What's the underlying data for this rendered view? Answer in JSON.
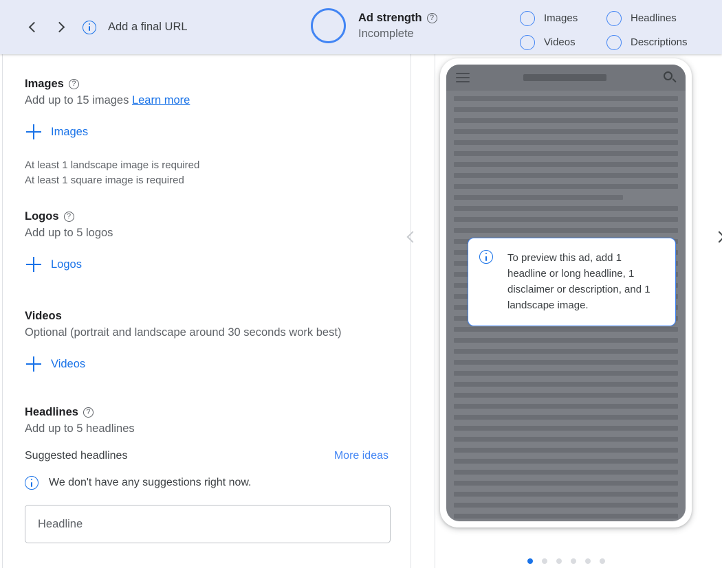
{
  "header": {
    "back_label": "Back",
    "forward_label": "Forward",
    "final_url_info_icon": "info-icon",
    "final_url_text": "Add a final URL",
    "ad_strength": {
      "label": "Ad strength",
      "help_icon": "help-icon",
      "status": "Incomplete",
      "progress": 0
    },
    "counters": [
      {
        "label": "Images",
        "progress": 0
      },
      {
        "label": "Headlines",
        "progress": 0
      },
      {
        "label": "Videos",
        "progress": 0
      },
      {
        "label": "Descriptions",
        "progress": 0
      }
    ]
  },
  "form": {
    "images": {
      "title": "Images",
      "help_icon": "help-icon",
      "subtitle": "Add up to 15 images",
      "learn_more": "Learn more",
      "add_button": "Images",
      "requirements": [
        "At least 1 landscape image is required",
        "At least 1 square image is required"
      ]
    },
    "logos": {
      "title": "Logos",
      "help_icon": "help-icon",
      "subtitle": "Add up to 5 logos",
      "add_button": "Logos"
    },
    "videos": {
      "title": "Videos",
      "subtitle": "Optional (portrait and landscape around 30 seconds work best)",
      "add_button": "Videos"
    },
    "headlines": {
      "title": "Headlines",
      "help_icon": "help-icon",
      "subtitle": "Add up to 5 headlines",
      "suggested_label": "Suggested headlines",
      "more_ideas": "More ideas",
      "no_suggestions": "We don't have any suggestions right now.",
      "input_placeholder": "Headline"
    }
  },
  "preview": {
    "prev_arrow": "chevron-left-icon",
    "next_arrow": "chevron-right-icon",
    "phone": {
      "menu_icon": "hamburger-menu-icon",
      "search_icon": "search-icon"
    },
    "notice": "To preview this ad, add 1 headline or long headline, 1 disclaimer or description, and 1 landscape image.",
    "dots_total": 6,
    "dots_active_index": 0
  },
  "colors": {
    "accent_blue": "#1a73e8",
    "link_blue": "#4285f4",
    "header_bg": "#e6eaf7",
    "text_primary": "#202124",
    "text_secondary": "#5f6368"
  }
}
